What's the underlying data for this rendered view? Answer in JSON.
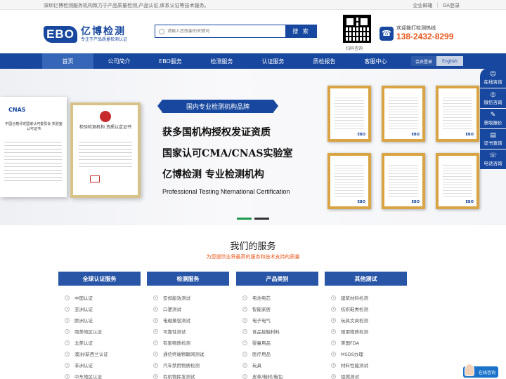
{
  "topbar": {
    "intro": "深圳亿博检测服务机构致力于产品质量检测,产品认证,体系认证等技术服务。",
    "links": [
      "企业邮箱",
      "OA登录"
    ]
  },
  "logo": {
    "mark": "EBO",
    "name": "亿博检测",
    "slogan": "专注于产品质量检测认证"
  },
  "search": {
    "placeholder": "请输入您想要的关键词",
    "button": "搜 索"
  },
  "qr": {
    "label": "扫码咨询"
  },
  "hotline": {
    "label": "欢迎拨打检测热线",
    "number": "138-2432-8299"
  },
  "nav": {
    "items": [
      "首页",
      "公司简介",
      "EBO服务",
      "检测服务",
      "认证服务",
      "质检报告",
      "客服中心"
    ],
    "member": "会员登录",
    "english": "English"
  },
  "banner": {
    "tag": "国内专业检测机构品牌",
    "line1": "获多国机构授权发证资质",
    "line2": "国家认可CMA/CNAS实验室",
    "line3": "亿博检测  专业检测机构",
    "english": "Professional Testing Nternational Certification",
    "cert1_logo": "CNAS",
    "cert1_title": "中国合格评定国家认可委员会 实验室认可证书",
    "cert2_title": "检验检测机构 资质认定证书"
  },
  "services": {
    "title": "我们的服务",
    "subtitle": "为您提供业界最高的服务和技术支持的质量",
    "columns": [
      {
        "title": "全球认证服务",
        "items": [
          "中国认证",
          "亚洲认证",
          "欧洲认证",
          "南美地区认证",
          "北美认证",
          "澳洲/新西兰认证",
          "非洲认证",
          "中东地区认证"
        ]
      },
      {
        "title": "检测服务",
        "items": [
          "安规能效测试",
          "口罩测试",
          "电磁兼容测试",
          "可靠性测试",
          "有害物质检测",
          "通信终端物联网测试",
          "汽车禁用物质检测",
          "有机物挥发测试"
        ]
      },
      {
        "title": "产品类别",
        "items": [
          "电池电芯",
          "智能家居",
          "电子电气",
          "食品接触材料",
          "婴童用品",
          "医疗用品",
          "玩具",
          "皮革/鞋材/箱包"
        ]
      },
      {
        "title": "其他测试",
        "items": [
          "建筑材料检测",
          "纺织鞋类检测",
          "玩具文具检测",
          "限用物质检测",
          "美国FDA",
          "MSDS办理",
          "材料性能测试",
          "阻燃测试"
        ]
      }
    ]
  },
  "float": {
    "items": [
      {
        "icon": "☺",
        "label": "在线咨询"
      },
      {
        "icon": "◎",
        "label": "微信咨询"
      },
      {
        "icon": "✎",
        "label": "获取报价"
      },
      {
        "icon": "▤",
        "label": "证书查询"
      },
      {
        "icon": "☏",
        "label": "电话咨询"
      }
    ],
    "online": "在线咨询"
  }
}
